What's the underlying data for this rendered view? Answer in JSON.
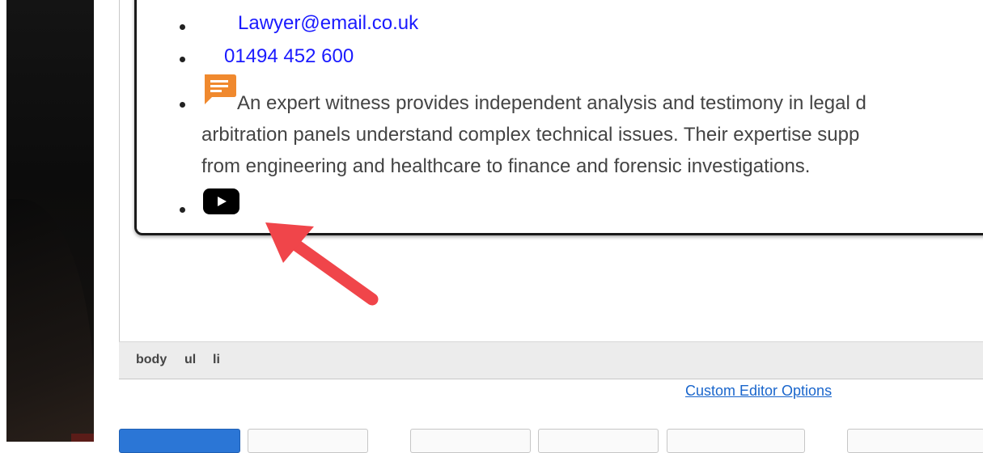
{
  "editor": {
    "list_items": {
      "email": "Lawyer@email.co.uk",
      "phone": "01494 452 600",
      "description_lines": [
        "An expert witness provides independent analysis and testimony in legal d",
        "arbitration panels understand complex technical issues. Their expertise supp",
        "from engineering and healthcare to finance and forensic investigations."
      ]
    },
    "path": [
      "body",
      "ul",
      "li"
    ]
  },
  "links": {
    "custom_editor_options": "Custom Editor Options"
  },
  "colors": {
    "link": "#1a1aff",
    "chat_icon": "#f0892e",
    "youtube_icon": "#000000",
    "annotation_arrow": "#f0454a",
    "primary_button": "#2b76d6"
  },
  "icons": {
    "chat": "chat-bubble-icon",
    "youtube": "youtube-play-icon",
    "annotation": "red-arrow-annotation"
  }
}
